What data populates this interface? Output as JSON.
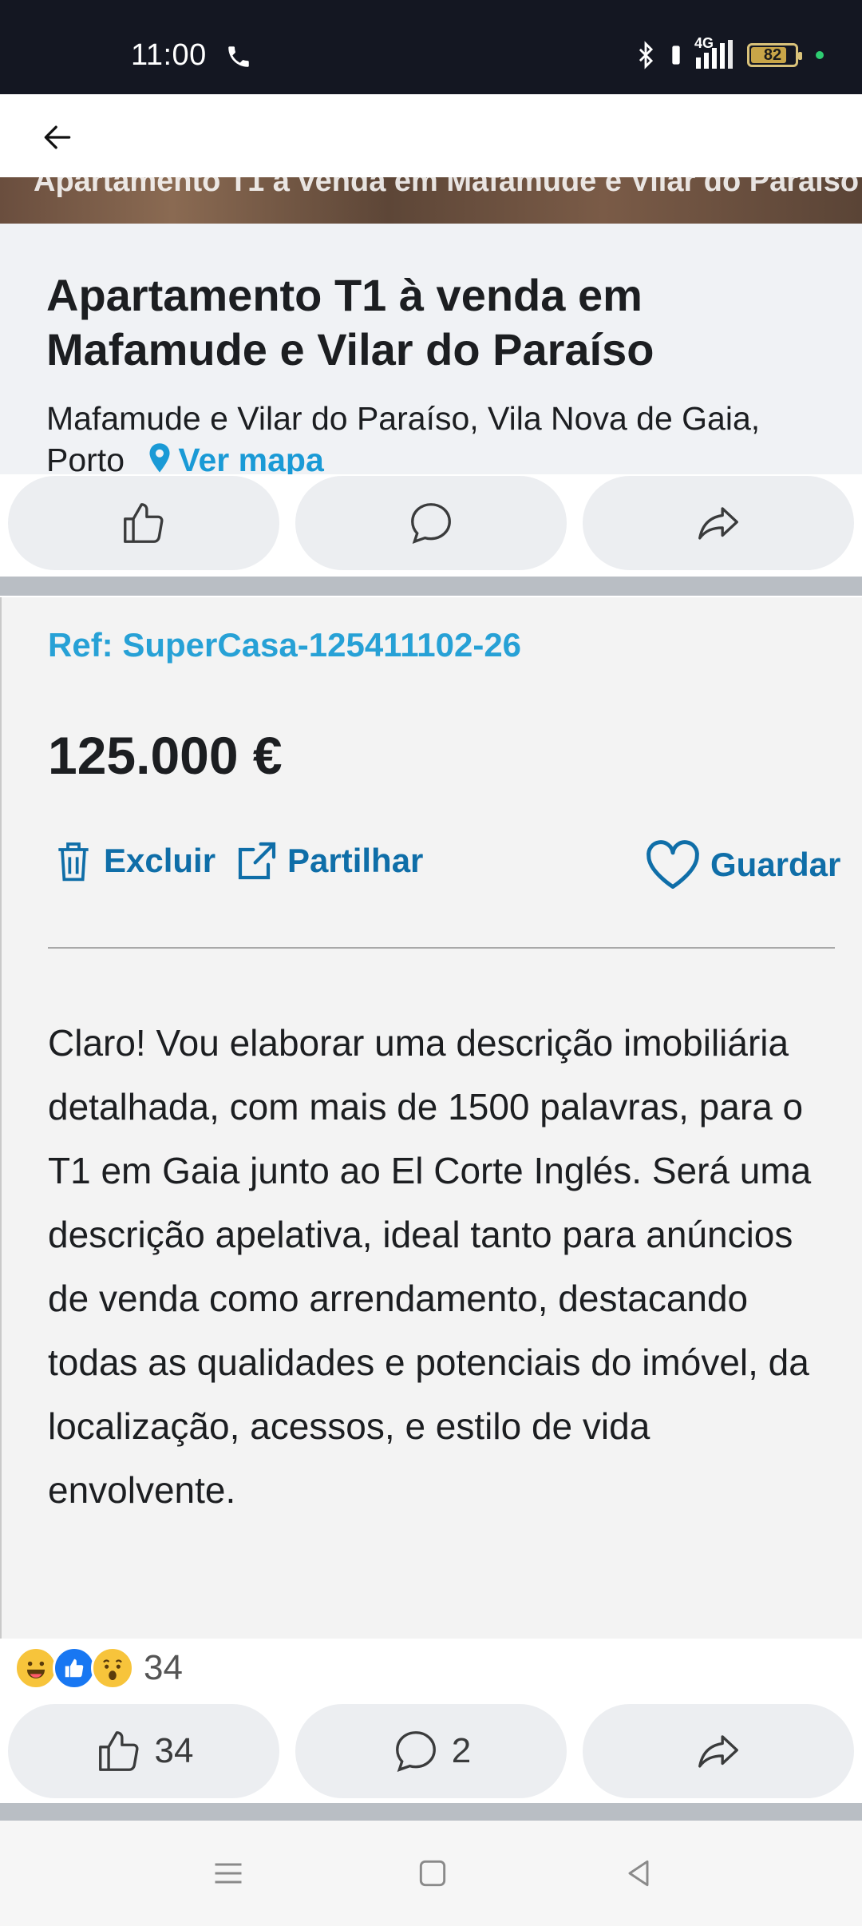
{
  "status_bar": {
    "time": "11:00",
    "network": "4G",
    "battery": "82",
    "battery_level_pct": 82
  },
  "app_bar": {
    "back_icon": "arrow-left-icon"
  },
  "photo_caption": "Apartamento T1 à venda em Mafamude e Vilar do Paraíso",
  "listing": {
    "title": "Apartamento T1 à venda em Mafamude e Vilar do Paraíso",
    "address": "Mafamude e Vilar do Paraíso, Vila Nova de Gaia, Porto",
    "map_link": "Ver mapa",
    "ref": "Ref: SuperCasa-125411102-26",
    "price": "125.000 €",
    "actions": {
      "delete": "Excluir",
      "share": "Partilhar",
      "save": "Guardar"
    },
    "description": "Claro! Vou elaborar uma descrição imobiliária detalhada, com mais de 1500 palavras, para o T1 em Gaia junto ao El Corte Inglés. Será uma descrição apelativa, ideal tanto para anúncios de venda como arrendamento, destacando todas as qualidades e potenciais do imóvel, da localização, acessos, e estilo de vida envolvente."
  },
  "reactions": {
    "count": "34",
    "types": [
      "haha",
      "like",
      "wow"
    ]
  },
  "post_actions": {
    "like_count": "34",
    "comment_count": "2"
  },
  "colors": {
    "accent_link": "#27a1d6",
    "action_blue": "#0f6ea8",
    "status_bar_bg": "#141722"
  }
}
